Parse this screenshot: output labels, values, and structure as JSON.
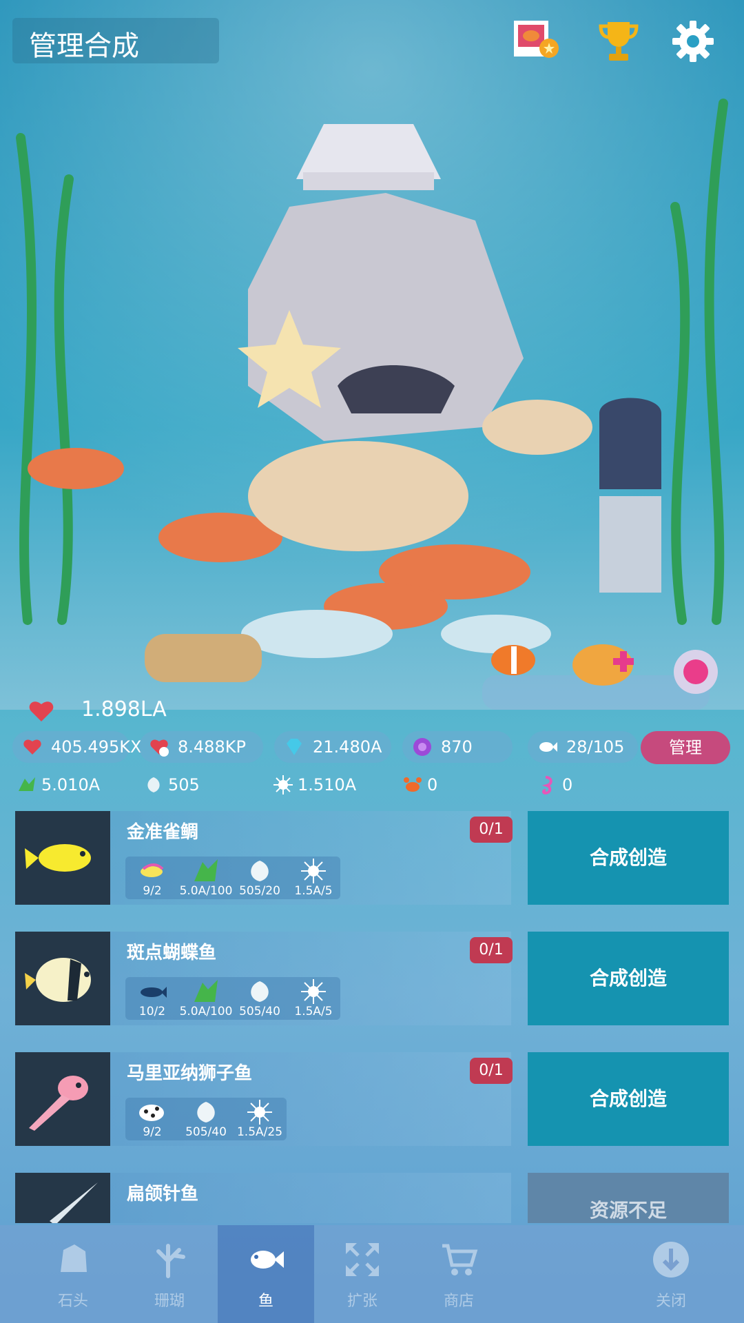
{
  "header": {
    "title": "管理合成"
  },
  "top_icons": [
    "album-icon",
    "trophy-icon",
    "gear-icon"
  ],
  "currency": {
    "vitality": "1.898LA",
    "vitality_per_tap": "405.495KX",
    "vitality_per_sec": "8.488KP",
    "gems": "21.480A",
    "pearls": "870",
    "fish_count": "28/105",
    "seaweed": "5.010A",
    "shells": "505",
    "urchins": "1.510A",
    "crabs": "0",
    "seahorses": "0"
  },
  "manage_button": "管理",
  "recipes": [
    {
      "name": "金准雀鲷",
      "owned": "0/1",
      "action": "合成创造",
      "requirements": [
        {
          "icon": "fish-icon",
          "label": "9/2"
        },
        {
          "icon": "seaweed-icon",
          "label": "5.0A/100"
        },
        {
          "icon": "shell-icon",
          "label": "505/20"
        },
        {
          "icon": "urchin-icon",
          "label": "1.5A/5"
        }
      ]
    },
    {
      "name": "斑点蝴蝶鱼",
      "owned": "0/1",
      "action": "合成创造",
      "requirements": [
        {
          "icon": "fish-icon",
          "label": "10/2"
        },
        {
          "icon": "seaweed-icon",
          "label": "5.0A/100"
        },
        {
          "icon": "shell-icon",
          "label": "505/40"
        },
        {
          "icon": "urchin-icon",
          "label": "1.5A/5"
        }
      ]
    },
    {
      "name": "马里亚纳狮子鱼",
      "owned": "0/1",
      "action": "合成创造",
      "requirements": [
        {
          "icon": "spotted-fish-icon",
          "label": "9/2"
        },
        {
          "icon": "shell-icon",
          "label": "505/40"
        },
        {
          "icon": "urchin-icon",
          "label": "1.5A/25"
        }
      ]
    },
    {
      "name": "扁颌针鱼",
      "owned": "",
      "action": "资源不足",
      "requirements": []
    }
  ],
  "tabs": [
    {
      "label": "石头",
      "icon": "stone-icon"
    },
    {
      "label": "珊瑚",
      "icon": "coral-icon"
    },
    {
      "label": "鱼",
      "icon": "fish-icon"
    },
    {
      "label": "扩张",
      "icon": "expand-icon"
    },
    {
      "label": "商店",
      "icon": "cart-icon"
    },
    {
      "label": "关闭",
      "icon": "close-down-icon"
    }
  ],
  "colors": {
    "accent": "#1593b0",
    "badge": "#c03a52",
    "manage": "#c64a7d"
  }
}
